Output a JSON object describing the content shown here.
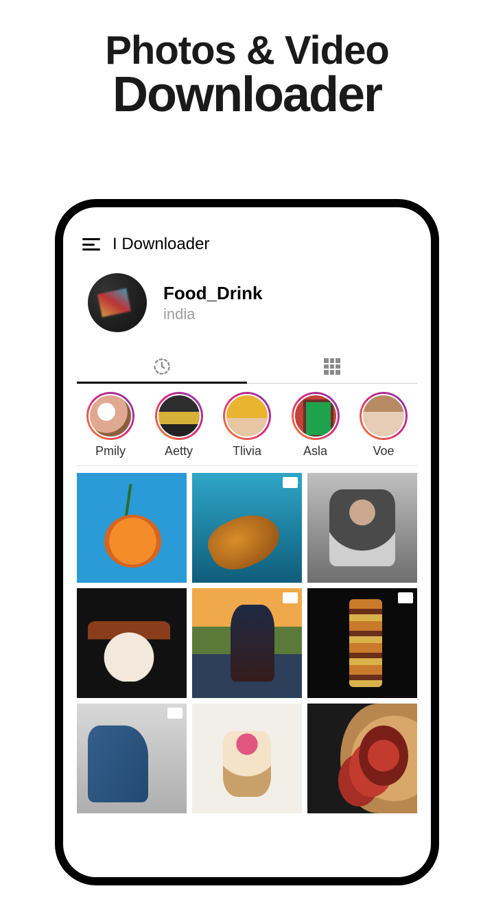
{
  "hero": {
    "line1": "Photos & Video",
    "line2": "Downloader"
  },
  "app": {
    "title": "I Downloader"
  },
  "profile": {
    "username": "Food_Drink",
    "location": "india"
  },
  "tabs": {
    "history": "history",
    "grid": "grid"
  },
  "stories": [
    {
      "label": "Pmily"
    },
    {
      "label": "Aetty"
    },
    {
      "label": "Tlivia"
    },
    {
      "label": "Asla"
    },
    {
      "label": "Voe"
    }
  ],
  "posts": [
    {
      "is_video": false
    },
    {
      "is_video": true
    },
    {
      "is_video": false
    },
    {
      "is_video": false
    },
    {
      "is_video": true
    },
    {
      "is_video": true
    },
    {
      "is_video": true
    },
    {
      "is_video": false
    },
    {
      "is_video": false
    }
  ]
}
